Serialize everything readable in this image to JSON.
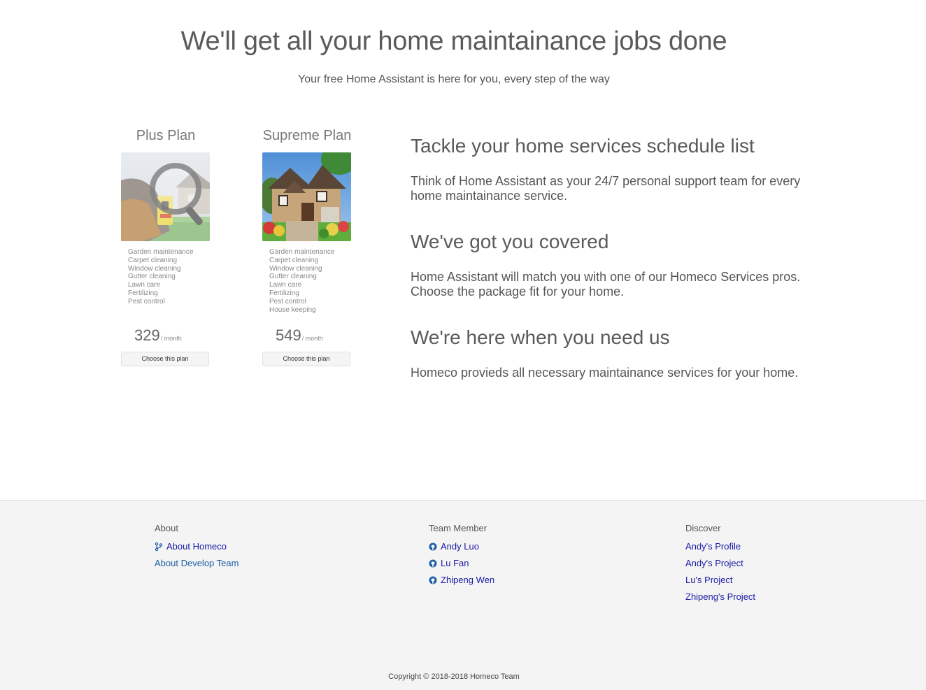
{
  "hero": {
    "title": "We'll get all your home maintainance jobs done",
    "subtitle": "Your free Home Assistant is here for you, every step of the way"
  },
  "plans": [
    {
      "name": "Plus Plan",
      "features": [
        "Garden maintenance",
        "Carpet cleaning",
        "Window cleaning",
        "Gutter cleaning",
        "Lawn care",
        "Fertilizing",
        "Pest control"
      ],
      "price": "329",
      "per": "/ month",
      "button": "Choose this plan"
    },
    {
      "name": "Supreme Plan",
      "features": [
        "Garden maintenance",
        "Carpet cleaning",
        "Window cleaning",
        "Gutter cleaning",
        "Lawn care",
        "Fertilizing",
        "Pest control",
        "House keeping"
      ],
      "price": "549",
      "per": "/ month",
      "button": "Choose this plan"
    }
  ],
  "features": [
    {
      "heading": "Tackle your home services schedule list",
      "text": "Think of Home Assistant as your 24/7 personal support team for every home maintainance service."
    },
    {
      "heading": "We've got you covered",
      "text": "Home Assistant will match you with one of our Homeco Services pros. Choose the package fit for your home."
    },
    {
      "heading": "We're here when you need us",
      "text": "Homeco provieds all necessary maintainance services for your home."
    }
  ],
  "footer": {
    "about": {
      "heading": "About",
      "links": [
        {
          "label": "About Homeco",
          "icon": "code-branch-icon"
        },
        {
          "label": "About Develop Team"
        }
      ]
    },
    "team": {
      "heading": "Team Member",
      "links": [
        {
          "label": "Andy Luo",
          "icon": "github-icon"
        },
        {
          "label": "Lu Fan",
          "icon": "github-icon"
        },
        {
          "label": "Zhipeng Wen",
          "icon": "github-icon"
        }
      ]
    },
    "discover": {
      "heading": "Discover",
      "links": [
        {
          "label": "Andy's Profile"
        },
        {
          "label": "Andy's Project"
        },
        {
          "label": "Lu's Project"
        },
        {
          "label": "Zhipeng's Project"
        }
      ]
    },
    "copyright": "Copyright © 2018-2018 Homeco Team"
  },
  "colors": {
    "link": "#1a1aa6",
    "link_alt": "#1f5fa8",
    "footer_bg": "#f4f4f4",
    "heading": "#5a5a5a"
  }
}
